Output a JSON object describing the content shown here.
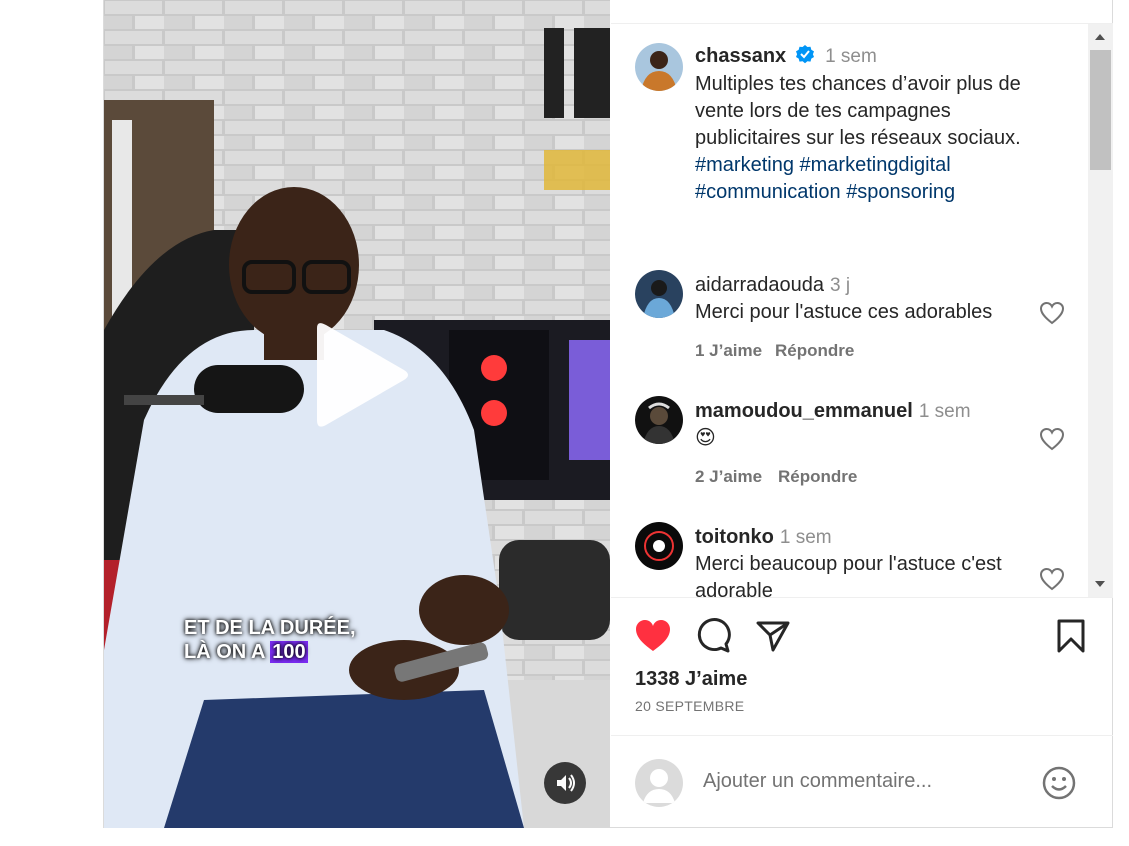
{
  "post": {
    "username": "chassanx",
    "time": "1 sem",
    "caption_lines": [
      "Multiples tes chances d’avoir plus de",
      "vente lors de tes campagnes",
      "publicitaires sur les réseaux sociaux."
    ],
    "hashtags_line1": [
      "#marketing",
      "#marketingdigital"
    ],
    "hashtags_line2": [
      "#communication",
      "#sponsoring"
    ]
  },
  "video": {
    "overlay_line1": "ET DE LA DURÉE,",
    "overlay_line2_prefix": "LÀ ON A",
    "overlay_highlight": "100"
  },
  "comments": [
    {
      "username": "aidarradaouda",
      "time": "3 j",
      "text": "Merci pour l'astuce ces adorables",
      "likes": "1 J’aime",
      "reply": "Répondre"
    },
    {
      "username": "mamoudou_emmanuel",
      "time": "1 sem",
      "text": "😍",
      "likes": "2 J’aime",
      "reply": "Répondre"
    },
    {
      "username": "toitonko",
      "time": "1 sem",
      "text_line1": "Merci beaucoup pour l'astuce c'est",
      "text_line2": "adorable"
    }
  ],
  "stats": {
    "likes": "1338 J’aime",
    "date": "20 SEPTEMBRE"
  },
  "comment_box": {
    "placeholder": "Ajouter un commentaire..."
  },
  "colors": {
    "like_red": "#ff3040",
    "hashtag": "#00376b",
    "verified": "#0095f6",
    "secondary": "#8e8e8e"
  }
}
